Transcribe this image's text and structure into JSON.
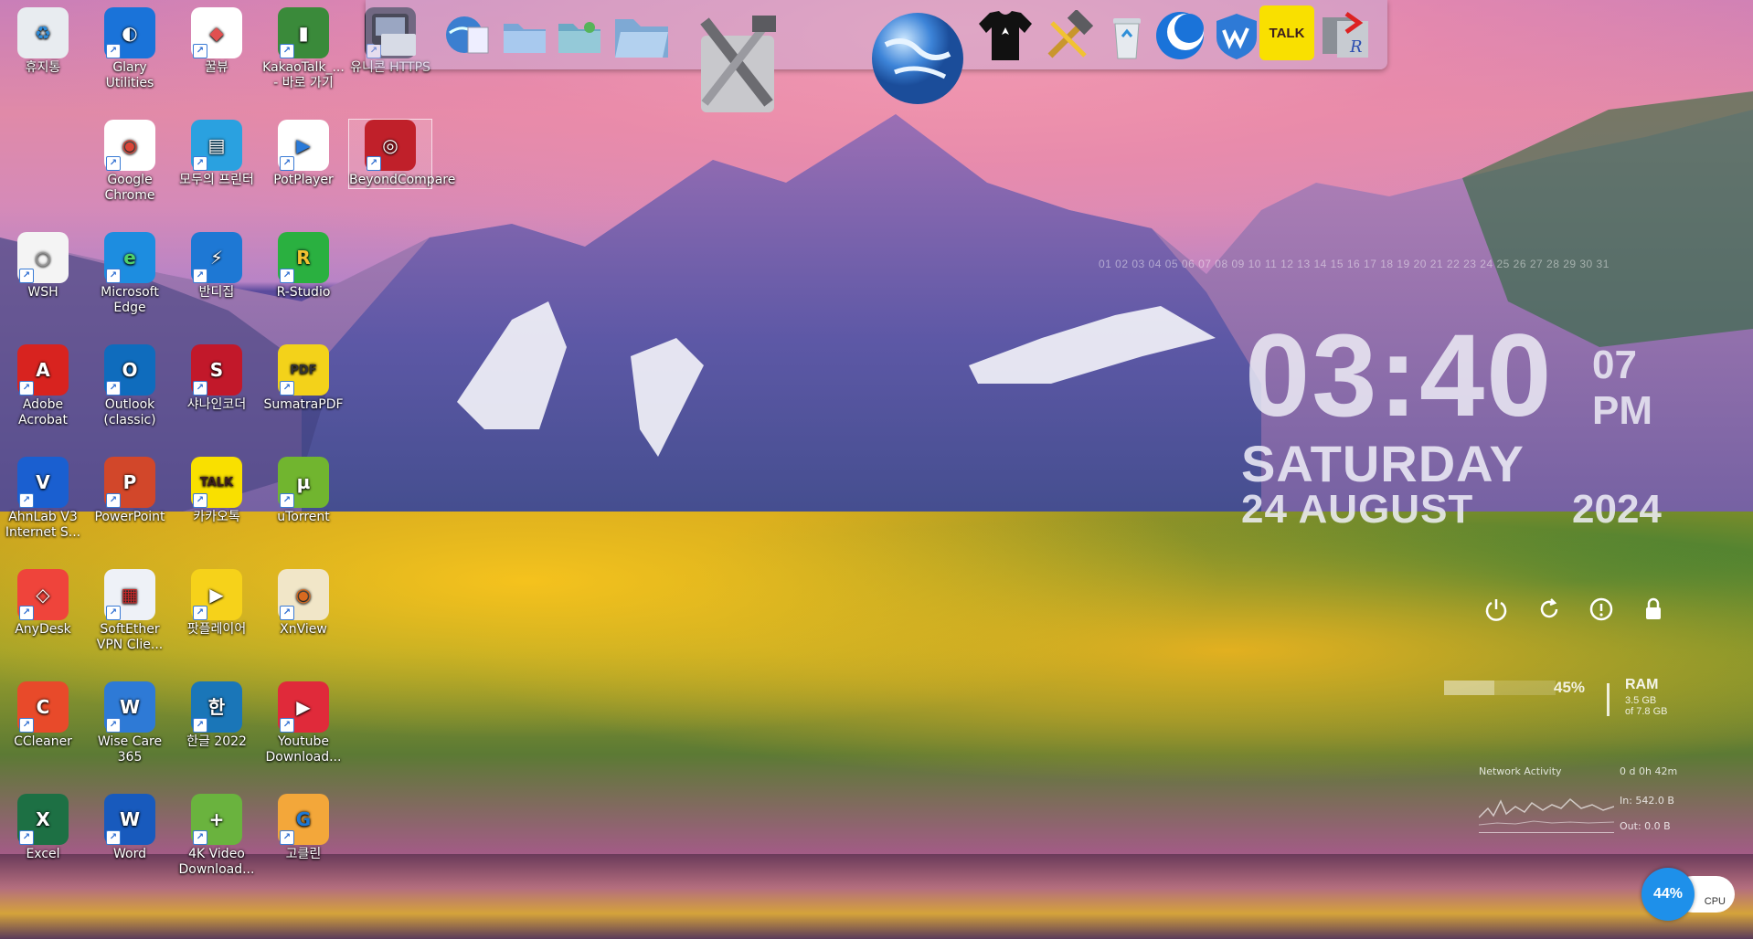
{
  "desktop": {
    "icons": [
      {
        "label": "휴지통",
        "icon": "recycle-bin-icon"
      },
      {
        "label": "Glary Utilities",
        "icon": "glary-icon"
      },
      {
        "label": "꿀뷰",
        "icon": "honeyview-icon"
      },
      {
        "label": "KakaoTalk_... - 바로 가기",
        "icon": "kakaotalk-file-icon"
      },
      {
        "label": "유니콘 HTTPS",
        "icon": "https-icon"
      },
      {
        "label": "Google Chrome",
        "icon": "chrome-icon"
      },
      {
        "label": "모두의 프린터",
        "icon": "printer-icon"
      },
      {
        "label": "PotPlayer",
        "icon": "potplayer-icon"
      },
      {
        "label": "BeyondCompare",
        "icon": "beyondcompare-icon"
      },
      {
        "label": "WSH",
        "icon": "wsh-icon"
      },
      {
        "label": "Microsoft Edge",
        "icon": "edge-icon"
      },
      {
        "label": "반디집",
        "icon": "bandizip-icon"
      },
      {
        "label": "R-Studio",
        "icon": "rstudio-icon"
      },
      {
        "label": "Adobe Acrobat",
        "icon": "acrobat-icon"
      },
      {
        "label": "Outlook (classic)",
        "icon": "outlook-icon"
      },
      {
        "label": "샤나인코더",
        "icon": "shana-encoder-icon"
      },
      {
        "label": "SumatraPDF",
        "icon": "sumatrapdf-icon"
      },
      {
        "label": "AhnLab V3 Internet S...",
        "icon": "v3-icon"
      },
      {
        "label": "PowerPoint",
        "icon": "powerpoint-icon"
      },
      {
        "label": "카카오톡",
        "icon": "kakaotalk-icon"
      },
      {
        "label": "uTorrent",
        "icon": "utorrent-icon"
      },
      {
        "label": "AnyDesk",
        "icon": "anydesk-icon"
      },
      {
        "label": "SoftEther VPN Clie...",
        "icon": "softether-icon"
      },
      {
        "label": "팟플레이어",
        "icon": "potplayer-yellow-icon"
      },
      {
        "label": "XnView",
        "icon": "xnview-icon"
      },
      {
        "label": "CCleaner",
        "icon": "ccleaner-icon"
      },
      {
        "label": "Wise Care 365",
        "icon": "wisecare-icon"
      },
      {
        "label": "한글 2022",
        "icon": "hangul-icon"
      },
      {
        "label": "Youtube Download...",
        "icon": "youtube-downloader-icon"
      },
      {
        "label": "Excel",
        "icon": "excel-icon"
      },
      {
        "label": "Word",
        "icon": "word-icon"
      },
      {
        "label": "4K Video Download...",
        "icon": "4k-downloader-icon"
      },
      {
        "label": "고클린",
        "icon": "goclean-icon"
      }
    ]
  },
  "dock": {
    "items": [
      {
        "icon": "https-tool-icon"
      },
      {
        "icon": "globe-doc-icon"
      },
      {
        "icon": "folder-icon"
      },
      {
        "icon": "folder-green-icon"
      },
      {
        "icon": "folder-open-icon"
      },
      {
        "icon": "tools-icon"
      },
      {
        "icon": "globe-icon"
      },
      {
        "icon": "tshirt-icon"
      },
      {
        "icon": "hammer-icon"
      },
      {
        "icon": "recycle-bin-icon"
      },
      {
        "icon": "glary-icon"
      },
      {
        "icon": "wise-care-icon"
      },
      {
        "icon": "kakaotalk-icon",
        "label": "TALK"
      },
      {
        "icon": "registry-icon"
      }
    ]
  },
  "clock": {
    "time": "03:40",
    "seconds": "07",
    "ampm": "PM",
    "day": "SATURDAY",
    "date": "24 AUGUST",
    "year": "2024",
    "calendar_days": "01 02 03 04 05 06 07 08 09 10 11 12 13 14 15 16 17 18 19 20 21 22 23 24 25 26 27 28 29 30 31"
  },
  "power": {
    "buttons": [
      {
        "name": "power-icon"
      },
      {
        "name": "restart-icon"
      },
      {
        "name": "info-icon"
      },
      {
        "name": "lock-icon"
      }
    ]
  },
  "ram": {
    "percent": "45%",
    "percent_value": 0.45,
    "label": "RAM",
    "used": "3.5 GB",
    "total": "of 7.8 GB"
  },
  "network": {
    "title": "Network Activity",
    "uptime": "0 d 0h 42m",
    "in": "In: 542.0 B",
    "out": "Out: 0.0 B"
  },
  "cpu": {
    "percent": "44%",
    "label": "CPU"
  },
  "colors": {
    "cpu_accent": "#1e90ea",
    "kakao_yellow": "#f9e000"
  }
}
